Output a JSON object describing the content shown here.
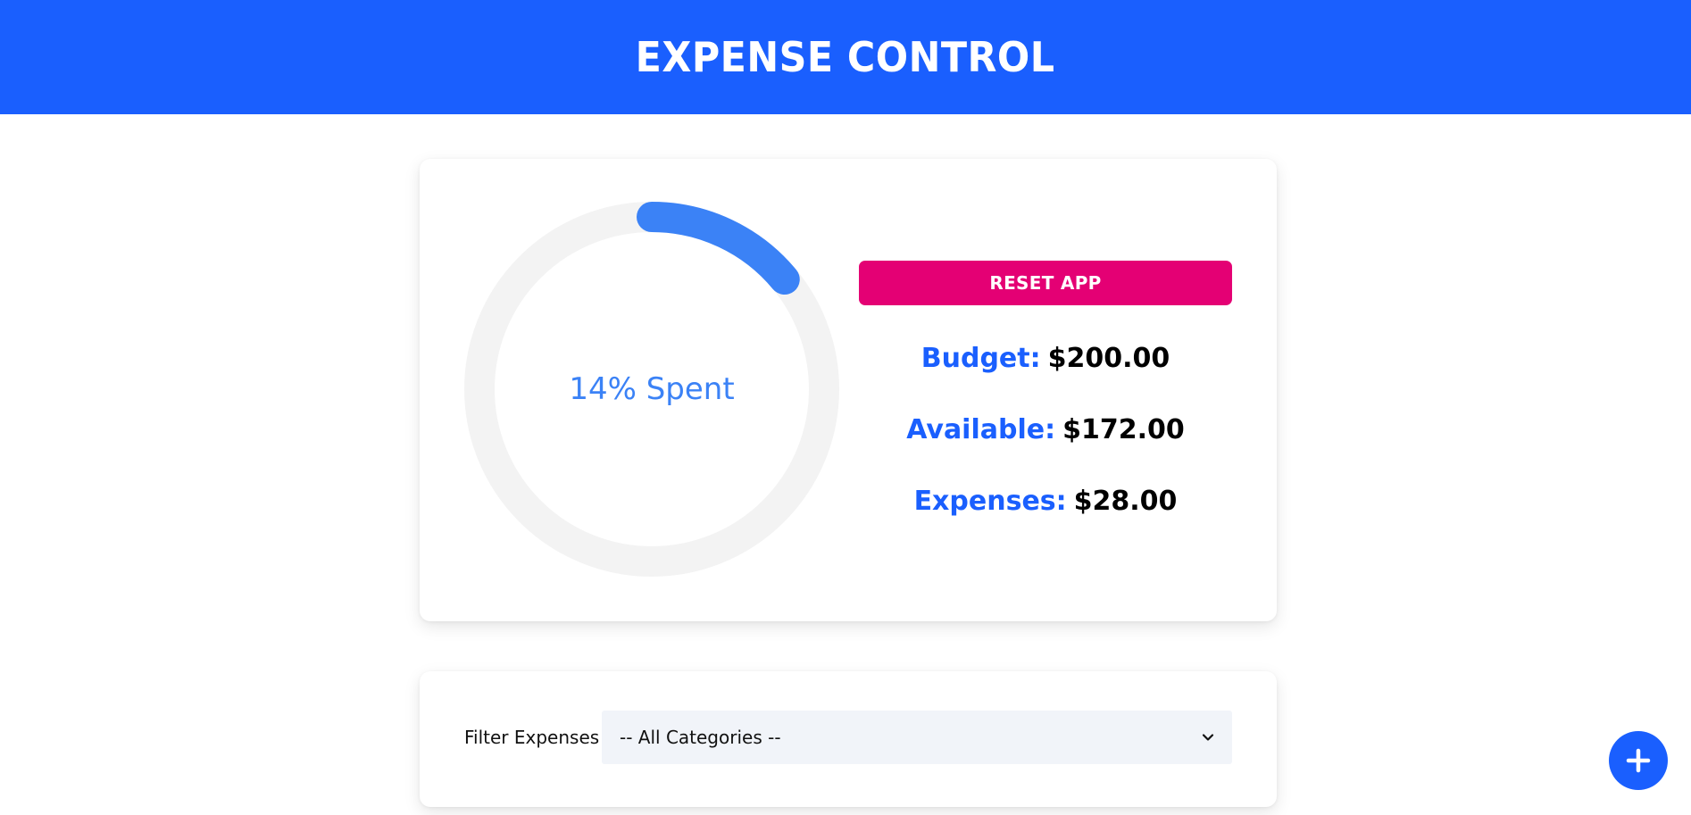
{
  "header": {
    "title": "EXPENSE CONTROL"
  },
  "budget_panel": {
    "progress": {
      "percent": 14,
      "label": "14% Spent",
      "track_color": "#f3f3f3",
      "bar_color": "#3b82f6"
    },
    "reset_label": "RESET APP",
    "stats": [
      {
        "label": "Budget:",
        "value": "$200.00"
      },
      {
        "label": "Available:",
        "value": "$172.00"
      },
      {
        "label": "Expenses:",
        "value": "$28.00"
      }
    ]
  },
  "filter": {
    "label": "Filter Expenses",
    "selected": "-- All Categories --"
  },
  "fab": {
    "icon": "plus-icon"
  },
  "colors": {
    "brand": "#1a5ffe",
    "reset": "#e40074",
    "accent": "#3b82f6"
  }
}
